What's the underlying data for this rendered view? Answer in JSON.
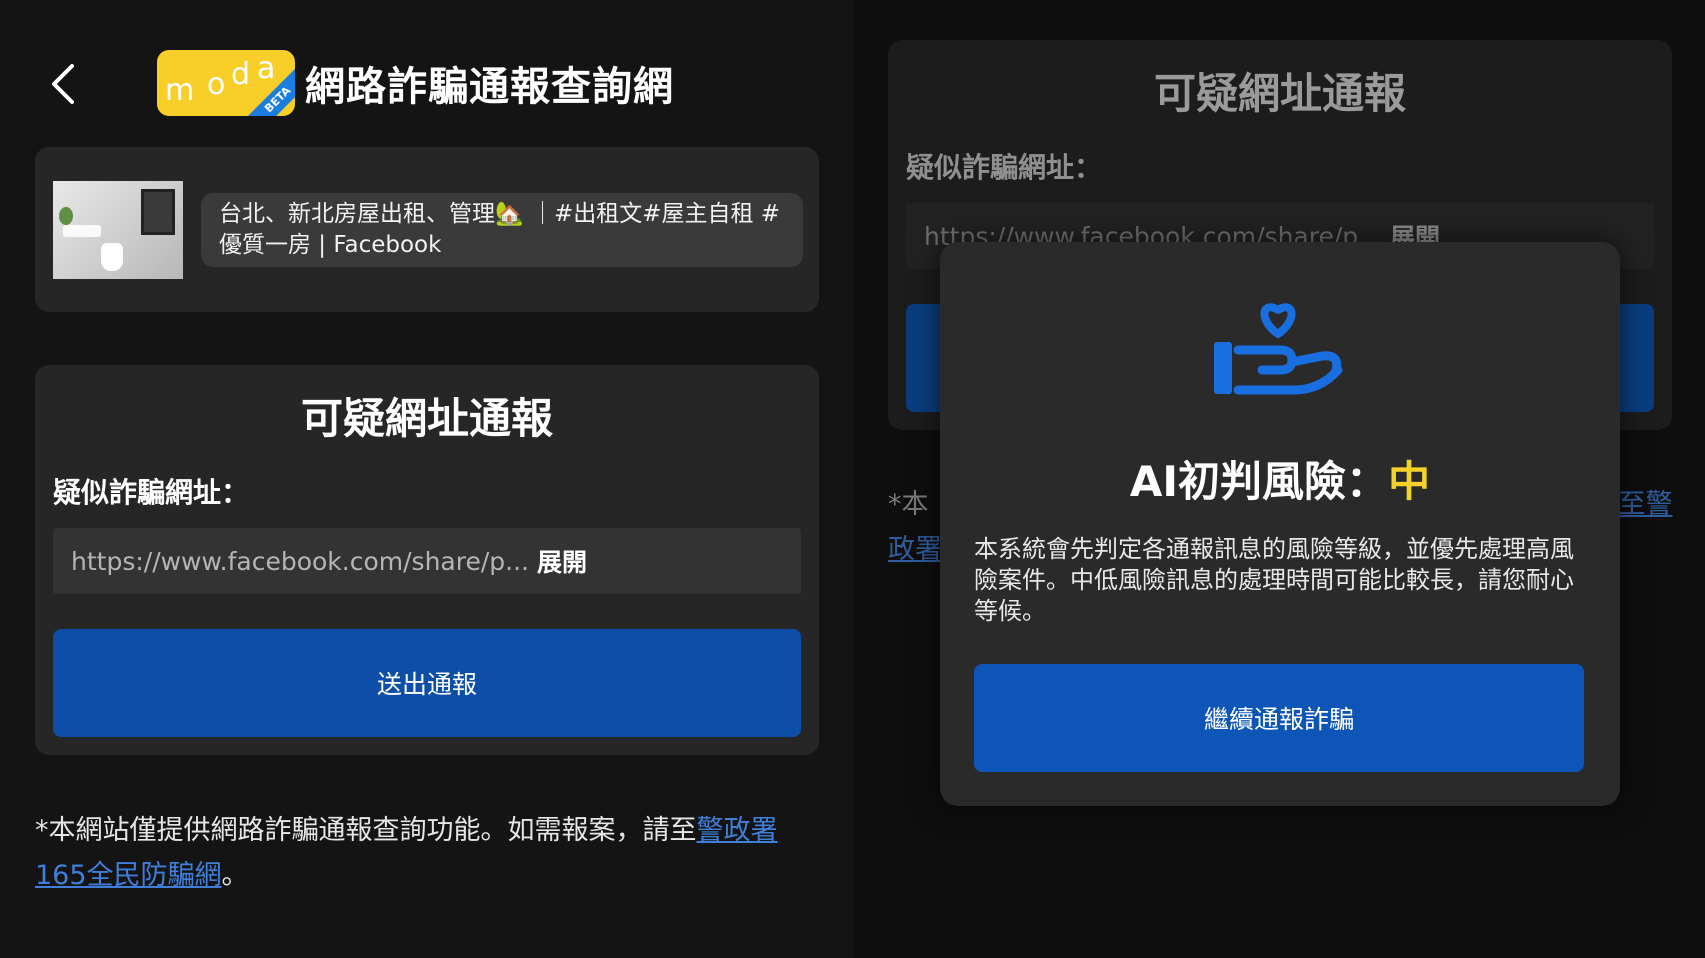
{
  "header": {
    "title": "網路詐騙通報查詢網",
    "logo_text": "moda",
    "logo_badge": "BETA"
  },
  "preview": {
    "text": "台北、新北房屋出租、管理🏡 ｜#出租文#屋主自租 #優質一房 | Facebook"
  },
  "report": {
    "title": "可疑網址通報",
    "field_label": "疑似詐騙網址：",
    "url_value": "https://www.facebook.com/share/p...",
    "expand_label": "展開",
    "submit_label": "送出通報"
  },
  "disclaimer": {
    "text": "*本網站僅提供網路詐騙通報查詢功能。如需報案，請至",
    "link": "警政署165全民防騙網",
    "end": "。"
  },
  "background": {
    "title": "可疑網址通報",
    "field_label": "疑似詐騙網址：",
    "url_value": "https://www.facebook.com/share/p...",
    "expand_label": "展開",
    "disclaimer_start": "*本",
    "disclaimer_link_end": "至警",
    "disclaimer_line2_link": "政署"
  },
  "modal": {
    "title_prefix": "AI初判風險：",
    "risk_level": "中",
    "risk_color": "#f5d22a",
    "body": "本系統會先判定各通報訊息的風險等級，並優先處理高風險案件。中低風險訊息的處理時間可能比較長，請您耐心等候。",
    "continue_label": "繼續通報詐騙",
    "icon": "heart-hand-icon"
  },
  "colors": {
    "primary_button": "#0d4fa8",
    "modal_button": "#0d56b8",
    "link": "#3f7fd9",
    "logo_yellow": "#f7cf28"
  }
}
